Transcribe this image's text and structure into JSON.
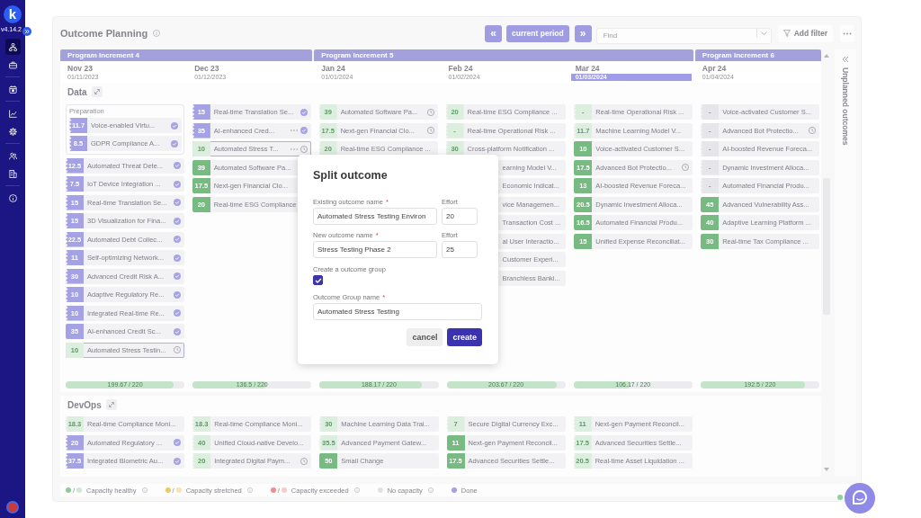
{
  "sidebar": {
    "logo": "k",
    "version": "v4.14.2",
    "nav": [
      {
        "selected": true
      },
      {
        "selected": false
      },
      {
        "selected": false
      },
      {
        "selected": false
      },
      {
        "selected": false
      },
      {
        "selected": false
      },
      {
        "selected": false
      },
      {
        "selected": false
      }
    ]
  },
  "header": {
    "title": "Outcome Planning",
    "previous": "«",
    "current": "current period",
    "next": "»",
    "search": {
      "placeholder": "Find"
    },
    "filter": "Add filter"
  },
  "increments": [
    {
      "label": "Program Increment 4",
      "months": [
        {
          "name": "Nov 23",
          "date": "01/11/2023",
          "selected": false
        },
        {
          "name": "Dec 23",
          "date": "01/12/2023",
          "selected": false
        }
      ]
    },
    {
      "label": "Program Increment 5",
      "months": [
        {
          "name": "Jan 24",
          "date": "01/01/2024",
          "selected": false
        },
        {
          "name": "Feb 24",
          "date": "01/02/2024",
          "selected": false
        },
        {
          "name": "Mar 24",
          "date": "01/03/2024",
          "selected": true
        }
      ]
    },
    {
      "label": "Program Increment 6",
      "months": [
        {
          "name": "Apr 24",
          "date": "01/04/2024",
          "selected": false
        }
      ]
    }
  ],
  "sections": [
    {
      "title": "Data",
      "columns": [
        {
          "items": [
            {
              "kind": "group",
              "label": "Preparation",
              "cards": [
                {
                  "kind": "done",
                  "effort": "11.7",
                  "title": "Voice-enabled Virtu...",
                  "continued": true,
                  "completed": true,
                  "pending": false,
                  "menu": false,
                  "selected": false
                },
                {
                  "kind": "done",
                  "effort": "8.5",
                  "title": "GDPR Compliance A...",
                  "continued": true,
                  "completed": true,
                  "pending": false,
                  "menu": false,
                  "selected": false
                }
              ]
            },
            {
              "kind": "done",
              "effort": "12.5",
              "title": "Automated Threat Dete...",
              "continued": true,
              "completed": true,
              "pending": false,
              "menu": false,
              "selected": false
            },
            {
              "kind": "done",
              "effort": "7.5",
              "title": "IoT Device Integration ...",
              "continued": true,
              "completed": true,
              "pending": false,
              "menu": false,
              "selected": false
            },
            {
              "kind": "done",
              "effort": "15",
              "title": "Real-time Translation Se...",
              "continued": true,
              "completed": true,
              "pending": false,
              "menu": false,
              "selected": false
            },
            {
              "kind": "done",
              "effort": "15",
              "title": "3D Visualization for Fina...",
              "continued": true,
              "completed": true,
              "pending": false,
              "menu": false,
              "selected": false
            },
            {
              "kind": "done",
              "effort": "22.5",
              "title": "Automated Debt Collec...",
              "continued": true,
              "completed": true,
              "pending": false,
              "menu": false,
              "selected": false
            },
            {
              "kind": "done",
              "effort": "11",
              "title": "Self-optimizing Network...",
              "continued": true,
              "completed": true,
              "pending": false,
              "menu": false,
              "selected": false
            },
            {
              "kind": "done",
              "effort": "30",
              "title": "Advanced Credit Risk A...",
              "continued": true,
              "completed": true,
              "pending": false,
              "menu": false,
              "selected": false
            },
            {
              "kind": "done",
              "effort": "10",
              "title": "Adaptive Regulatory Re...",
              "continued": true,
              "completed": true,
              "pending": false,
              "menu": false,
              "selected": false
            },
            {
              "kind": "done",
              "effort": "10",
              "title": "Integrated Real-time Re...",
              "continued": true,
              "completed": true,
              "pending": false,
              "menu": false,
              "selected": false
            },
            {
              "kind": "done",
              "effort": "35",
              "title": "AI-enhanced Credit Sc...",
              "continued": false,
              "completed": true,
              "pending": false,
              "menu": false,
              "selected": false
            },
            {
              "kind": "planned",
              "effort": "10",
              "title": "Automated Stress Testin...",
              "continued": false,
              "completed": false,
              "pending": true,
              "menu": false,
              "selected": true
            }
          ],
          "capacity": {
            "reading": "199.67 / 220",
            "level": 0.91
          }
        },
        {
          "items": [
            {
              "kind": "done",
              "effort": "15",
              "title": "Real-time Translation Se...",
              "continued": true,
              "completed": true,
              "pending": false,
              "menu": false,
              "selected": false
            },
            {
              "kind": "done",
              "effort": "35",
              "title": "AI-enhanced Cred...",
              "continued": true,
              "completed": true,
              "pending": false,
              "menu": true,
              "selected": false
            },
            {
              "kind": "planned",
              "effort": "10",
              "title": "Automated Stress T...",
              "continued": false,
              "completed": false,
              "pending": true,
              "menu": true,
              "selected": true
            },
            {
              "kind": "healthy",
              "effort": "39",
              "title": "Automated Software Pa...",
              "continued": false,
              "completed": false,
              "pending": false,
              "menu": false,
              "selected": false
            },
            {
              "kind": "healthy",
              "effort": "17.5",
              "title": "Next-gen Financial Clo...",
              "continued": false,
              "completed": false,
              "pending": false,
              "menu": false,
              "selected": false
            },
            {
              "kind": "healthy",
              "effort": "20",
              "title": "Real-time ESG Compliance",
              "continued": false,
              "completed": false,
              "pending": false,
              "menu": false,
              "selected": false
            }
          ],
          "capacity": {
            "reading": "136.5 / 220",
            "level": 0.62
          }
        },
        {
          "items": [
            {
              "kind": "planned",
              "effort": "39",
              "title": "Automated Software Pa...",
              "continued": true,
              "completed": false,
              "pending": true,
              "menu": false,
              "selected": false
            },
            {
              "kind": "planned",
              "effort": "17.5",
              "title": "Next-gen Financial Clo...",
              "continued": true,
              "completed": false,
              "pending": true,
              "menu": false,
              "selected": false
            },
            {
              "kind": "planned",
              "effort": "20",
              "title": "Real-time ESG Compliance ...",
              "continued": true,
              "completed": false,
              "pending": false,
              "menu": false,
              "selected": false
            }
          ],
          "capacity": {
            "reading": "188.17 / 220",
            "level": 0.86
          }
        },
        {
          "items": [
            {
              "kind": "planned",
              "effort": "20",
              "title": "Real-time ESG Compliance ...",
              "continued": true,
              "completed": false,
              "pending": false,
              "menu": false,
              "selected": false
            },
            {
              "kind": "planned",
              "effort": "-",
              "title": "Real-time Operational Risk ...",
              "continued": true,
              "completed": false,
              "pending": false,
              "menu": false,
              "selected": false
            },
            {
              "kind": "planned",
              "effort": "30",
              "title": "Cross-platform Notification ...",
              "continued": true,
              "completed": false,
              "pending": false,
              "menu": false,
              "selected": false
            },
            {
              "kind": "covered",
              "title": "earning Model V...",
              "completed": false,
              "pending": false,
              "menu": false,
              "selected": false
            },
            {
              "kind": "covered",
              "title": "Economic Indicat...",
              "completed": false,
              "pending": false,
              "menu": false,
              "selected": false
            },
            {
              "kind": "covered",
              "title": "vice Managemen...",
              "completed": false,
              "pending": false,
              "menu": false,
              "selected": false
            },
            {
              "kind": "covered",
              "title": "Transaction Cost ...",
              "completed": false,
              "pending": false,
              "menu": false,
              "selected": false
            },
            {
              "kind": "covered",
              "title": "al User Interactio...",
              "completed": false,
              "pending": false,
              "menu": false,
              "selected": false
            },
            {
              "kind": "covered",
              "title": "Customer Experi...",
              "completed": false,
              "pending": false,
              "menu": false,
              "selected": false
            },
            {
              "kind": "covered",
              "title": "Branchless Banki...",
              "completed": false,
              "pending": false,
              "menu": false,
              "selected": false
            }
          ],
          "capacity": {
            "reading": "203.67 / 220",
            "level": 0.93
          }
        },
        {
          "items": [
            {
              "kind": "planned",
              "effort": "-",
              "title": "Real-time Operational Risk ...",
              "continued": true,
              "completed": false,
              "pending": false,
              "menu": false,
              "selected": false
            },
            {
              "kind": "planned",
              "effort": "11.7",
              "title": "Machine Learning Model V...",
              "continued": true,
              "completed": false,
              "pending": false,
              "menu": false,
              "selected": false
            },
            {
              "kind": "healthy",
              "effort": "10",
              "title": "Voice-activated Customer S...",
              "continued": false,
              "completed": false,
              "pending": false,
              "menu": false,
              "selected": false
            },
            {
              "kind": "healthy",
              "effort": "17.5",
              "title": "Advanced Bot Protectio...",
              "continued": false,
              "completed": false,
              "pending": true,
              "menu": false,
              "selected": false
            },
            {
              "kind": "healthy",
              "effort": "13",
              "title": "AI-boosted Revenue Foreca...",
              "continued": false,
              "completed": false,
              "pending": false,
              "menu": false,
              "selected": false
            },
            {
              "kind": "healthy",
              "effort": "20.5",
              "title": "Dynamic Investment Alloca...",
              "continued": false,
              "completed": false,
              "pending": false,
              "menu": false,
              "selected": false
            },
            {
              "kind": "healthy",
              "effort": "16.5",
              "title": "Automated Financial Produ...",
              "continued": false,
              "completed": false,
              "pending": false,
              "menu": false,
              "selected": false
            },
            {
              "kind": "healthy",
              "effort": "15",
              "title": "Unified Expense Reconciliat...",
              "continued": false,
              "completed": false,
              "pending": false,
              "menu": false,
              "selected": false
            }
          ],
          "capacity": {
            "reading": "106.17 / 220",
            "level": 0.48
          }
        },
        {
          "items": [
            {
              "kind": "unassigned",
              "effort": "-",
              "title": "Voice-activated Customer S...",
              "continued": true,
              "completed": false,
              "pending": false,
              "menu": false,
              "selected": false
            },
            {
              "kind": "unassigned",
              "effort": "-",
              "title": "Advanced Bot Protectio...",
              "continued": true,
              "completed": false,
              "pending": true,
              "menu": false,
              "selected": false
            },
            {
              "kind": "unassigned",
              "effort": "-",
              "title": "AI-boosted Revenue Foreca...",
              "continued": true,
              "completed": false,
              "pending": false,
              "menu": false,
              "selected": false
            },
            {
              "kind": "unassigned",
              "effort": "-",
              "title": "Dynamic Investment Alloca...",
              "continued": true,
              "completed": false,
              "pending": false,
              "menu": false,
              "selected": false
            },
            {
              "kind": "unassigned",
              "effort": "-",
              "title": "Automated Financial Produ...",
              "continued": true,
              "completed": false,
              "pending": false,
              "menu": false,
              "selected": false
            },
            {
              "kind": "healthy",
              "effort": "45",
              "title": "Advanced Vulnerability Ass...",
              "continued": false,
              "completed": false,
              "pending": false,
              "menu": false,
              "selected": false
            },
            {
              "kind": "healthy",
              "effort": "40",
              "title": "Adaptive Learning Platform ...",
              "continued": false,
              "completed": false,
              "pending": false,
              "menu": false,
              "selected": false
            },
            {
              "kind": "healthy",
              "effort": "30",
              "title": "Real-time Tax Compliance ...",
              "continued": false,
              "completed": false,
              "pending": false,
              "menu": false,
              "selected": false
            }
          ],
          "capacity": {
            "reading": "192.5 / 220",
            "level": 0.88
          }
        }
      ]
    },
    {
      "title": "DevOps",
      "columns": [
        {
          "items": [
            {
              "kind": "planned",
              "effort": "18.3",
              "title": "Real-time Compliance Moni...",
              "continued": true,
              "completed": false,
              "pending": false,
              "menu": false,
              "selected": false
            },
            {
              "kind": "done",
              "effort": "20",
              "title": "Automated Regulatory ...",
              "continued": true,
              "completed": true,
              "pending": false,
              "menu": false,
              "selected": false
            },
            {
              "kind": "done",
              "effort": "37.5",
              "title": "Integrated Biometric Au...",
              "continued": true,
              "completed": true,
              "pending": false,
              "menu": false,
              "selected": false
            }
          ]
        },
        {
          "items": [
            {
              "kind": "planned",
              "effort": "18.3",
              "title": "Real-time Compliance Moni...",
              "continued": true,
              "completed": false,
              "pending": false,
              "menu": false,
              "selected": false
            },
            {
              "kind": "planned",
              "effort": "40",
              "title": "Unified Cloud-native Develo...",
              "continued": true,
              "completed": false,
              "pending": false,
              "menu": false,
              "selected": false
            },
            {
              "kind": "planned",
              "effort": "20",
              "title": "Integrated Digital Paym...",
              "continued": true,
              "completed": false,
              "pending": true,
              "menu": false,
              "selected": false
            }
          ]
        },
        {
          "items": [
            {
              "kind": "planned",
              "effort": "30",
              "title": "Machine Learning Data Trai...",
              "continued": true,
              "completed": false,
              "pending": false,
              "menu": false,
              "selected": false
            },
            {
              "kind": "planned",
              "effort": "35.5",
              "title": "Advanced Payment Gatew...",
              "continued": true,
              "completed": false,
              "pending": false,
              "menu": false,
              "selected": false
            },
            {
              "kind": "healthy",
              "effort": "50",
              "title": "Small Change",
              "continued": false,
              "completed": false,
              "pending": false,
              "menu": false,
              "selected": false
            }
          ]
        },
        {
          "items": [
            {
              "kind": "planned",
              "effort": "7",
              "title": "Secure Digital Currency Exc...",
              "continued": true,
              "completed": false,
              "pending": false,
              "menu": false,
              "selected": false
            },
            {
              "kind": "healthy",
              "effort": "11",
              "title": "Next-gen Payment Reconcil...",
              "continued": false,
              "completed": false,
              "pending": false,
              "menu": false,
              "selected": false
            },
            {
              "kind": "healthy",
              "effort": "17.5",
              "title": "Advanced Securities Settle...",
              "continued": false,
              "completed": false,
              "pending": false,
              "menu": false,
              "selected": false
            }
          ]
        },
        {
          "items": [
            {
              "kind": "planned",
              "effort": "11",
              "title": "Next-gen Payment Reconcil...",
              "continued": true,
              "completed": false,
              "pending": false,
              "menu": false,
              "selected": false
            },
            {
              "kind": "planned",
              "effort": "17.5",
              "title": "Advanced Securities Settle...",
              "continued": true,
              "completed": false,
              "pending": false,
              "menu": false,
              "selected": false
            },
            {
              "kind": "planned",
              "effort": "20.5",
              "title": "Real-time Asset Liquidation ...",
              "continued": true,
              "completed": false,
              "pending": false,
              "menu": false,
              "selected": false
            }
          ]
        }
      ]
    }
  ],
  "unplanned": {
    "label": "Unplanned outcomes"
  },
  "legend": [
    {
      "label": "Capacity healthy",
      "divider": "/",
      "swatches": [
        {
          "color": "#8fcb97"
        },
        {
          "color": "#cfe9d3"
        }
      ],
      "info": true
    },
    {
      "label": "Capacity stretched",
      "divider": "/",
      "swatches": [
        {
          "color": "#f0c766"
        },
        {
          "color": "#f9e4b0"
        }
      ],
      "info": true
    },
    {
      "label": "Capacity exceeded",
      "divider": "/",
      "swatches": [
        {
          "color": "#ee8f8f"
        },
        {
          "color": "#f7cccc"
        }
      ],
      "info": true
    },
    {
      "label": "No capacity",
      "swatches": [
        {
          "color": "#e2e2e6"
        }
      ],
      "info": true
    },
    {
      "label": "Done",
      "swatches": [
        {
          "color": "#a4a1e4"
        }
      ],
      "info": false
    }
  ],
  "dialog": {
    "title": "Split outcome",
    "rows": [
      {
        "name": {
          "label": "Existing outcome name",
          "mark": "*",
          "value": "Automated Stress Testing Environ"
        },
        "effort": {
          "label": "Effort",
          "value": "20"
        }
      },
      {
        "name": {
          "label": "New outcome name",
          "mark": "*",
          "value": "Stress Testing Phase 2"
        },
        "effort": {
          "label": "Effort",
          "value": "25"
        }
      }
    ],
    "group_toggle": {
      "label": "Create a outcome group",
      "checked": true
    },
    "group_name": {
      "label": "Outcome Group name",
      "mark": "*",
      "value": "Automated Stress Testing"
    },
    "buttons": [
      {
        "label": "cancel",
        "kind": "secondary"
      },
      {
        "label": "create",
        "kind": "primary"
      }
    ]
  }
}
